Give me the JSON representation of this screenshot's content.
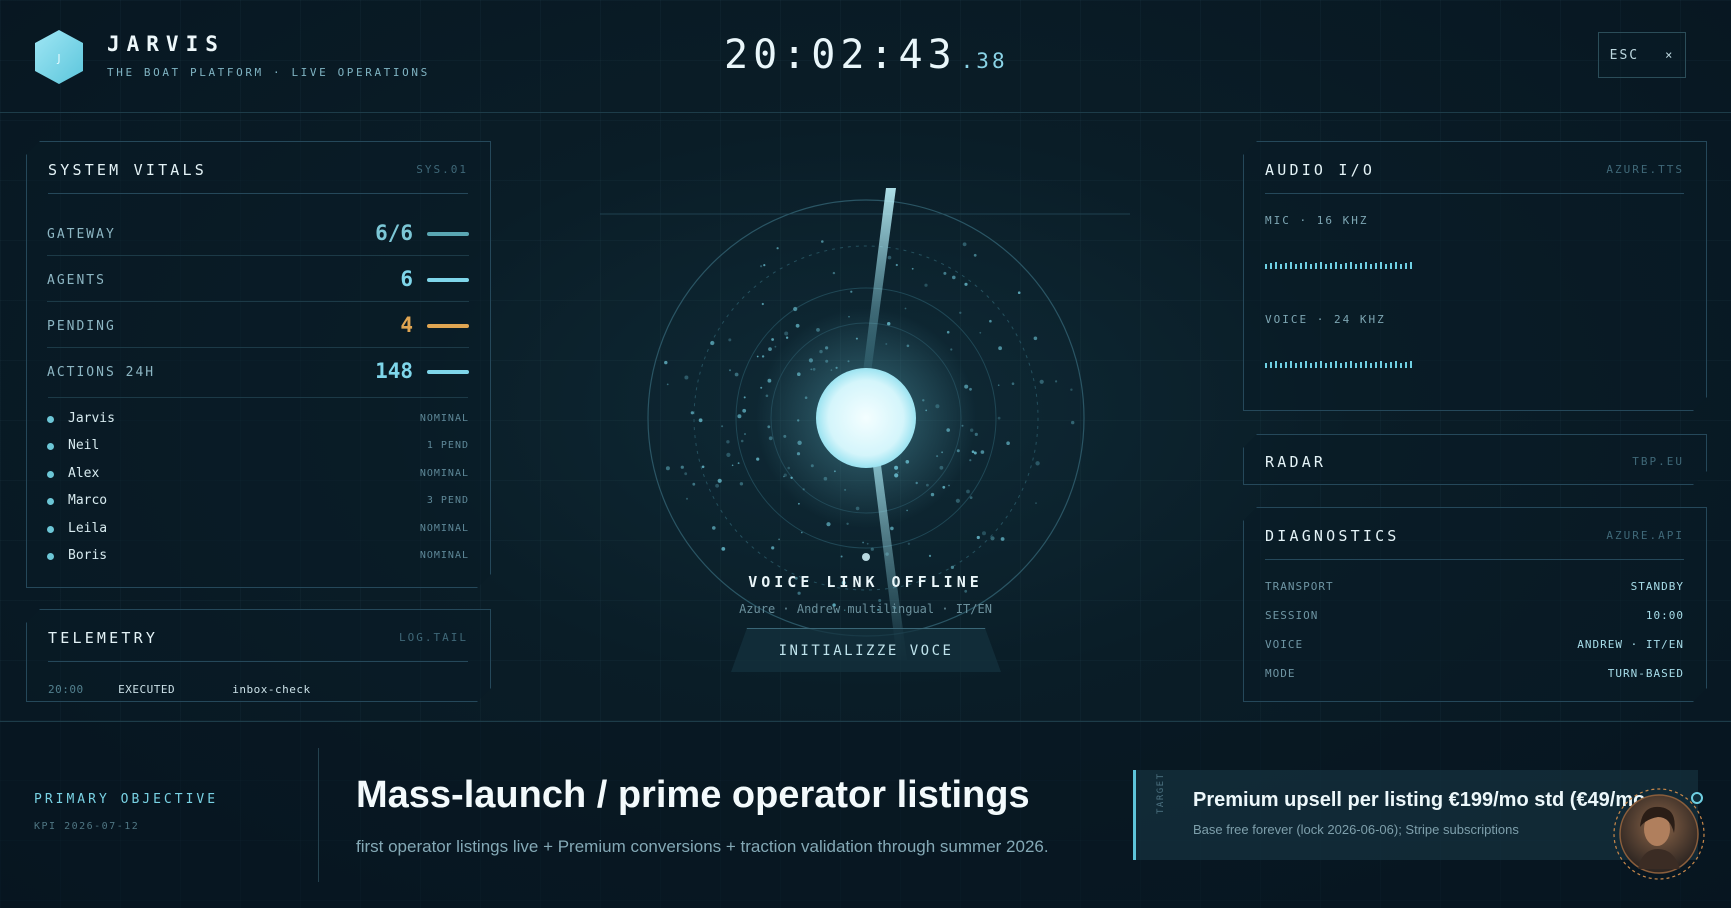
{
  "header": {
    "logo_letter": "J",
    "title": "JARVIS",
    "subtitle": "THE BOAT PLATFORM · LIVE OPERATIONS",
    "clock": "20:02:43",
    "clock_ms": ".38",
    "esc_label": "ESC",
    "esc_icon": "×"
  },
  "vitals": {
    "title": "SYSTEM VITALS",
    "tag": "SYS.01",
    "rows": [
      {
        "label": "GATEWAY",
        "value": "6/6",
        "color": "#5aa7b3"
      },
      {
        "label": "AGENTS",
        "value": "6",
        "color": "#7fd6ea"
      },
      {
        "label": "PENDING",
        "value": "4",
        "color": "#e0a552"
      },
      {
        "label": "ACTIONS 24H",
        "value": "148",
        "color": "#7fd6ea"
      }
    ],
    "agents": [
      {
        "name": "Jarvis",
        "status": "NOMINAL"
      },
      {
        "name": "Neil",
        "status": "1 PEND"
      },
      {
        "name": "Alex",
        "status": "NOMINAL"
      },
      {
        "name": "Marco",
        "status": "3 PEND"
      },
      {
        "name": "Leila",
        "status": "NOMINAL"
      },
      {
        "name": "Boris",
        "status": "NOMINAL"
      }
    ]
  },
  "telemetry": {
    "title": "TELEMETRY",
    "tag": "LOG.TAIL",
    "entries": [
      {
        "time": "20:00",
        "status": "EXECUTED",
        "task": "inbox-check"
      }
    ]
  },
  "audio": {
    "title": "AUDIO I/O",
    "tag": "AZURE.TTS",
    "mic_label": "MIC · 16 KHZ",
    "voice_label": "VOICE · 24 KHZ"
  },
  "radar": {
    "title": "RADAR",
    "tag": "TBP.EU"
  },
  "diagnostics": {
    "title": "DIAGNOSTICS",
    "tag": "AZURE.API",
    "rows": [
      {
        "key": "TRANSPORT",
        "value": "STANDBY"
      },
      {
        "key": "SESSION",
        "value": "10:00"
      },
      {
        "key": "VOICE",
        "value": "ANDREW · IT/EN"
      },
      {
        "key": "MODE",
        "value": "TURN-BASED"
      }
    ]
  },
  "voice": {
    "status": "VOICE LINK OFFLINE",
    "sub": "Azure · Andrew multilingual · IT/EN",
    "button": "INITIALIZZE VOCE"
  },
  "objective": {
    "label": "PRIMARY OBJECTIVE",
    "kpi": "KPI 2026-07-12",
    "title": "Mass-launch / prime operator listings",
    "desc": "first operator listings live + Premium conversions + traction validation through summer 2026.",
    "target_tag": "TARGET",
    "target_title": "Premium upsell per listing €199/mo std (€49/mo",
    "target_sub": "Base free forever (lock 2026-06-06); Stripe subscriptions"
  },
  "colors": {
    "accent": "#6fd0e3",
    "warning": "#e0a552",
    "panel_border": "#25485a"
  },
  "icons": {
    "logo": "hexagon-logo-icon",
    "close": "close-icon",
    "avatar": "assistant-avatar"
  }
}
